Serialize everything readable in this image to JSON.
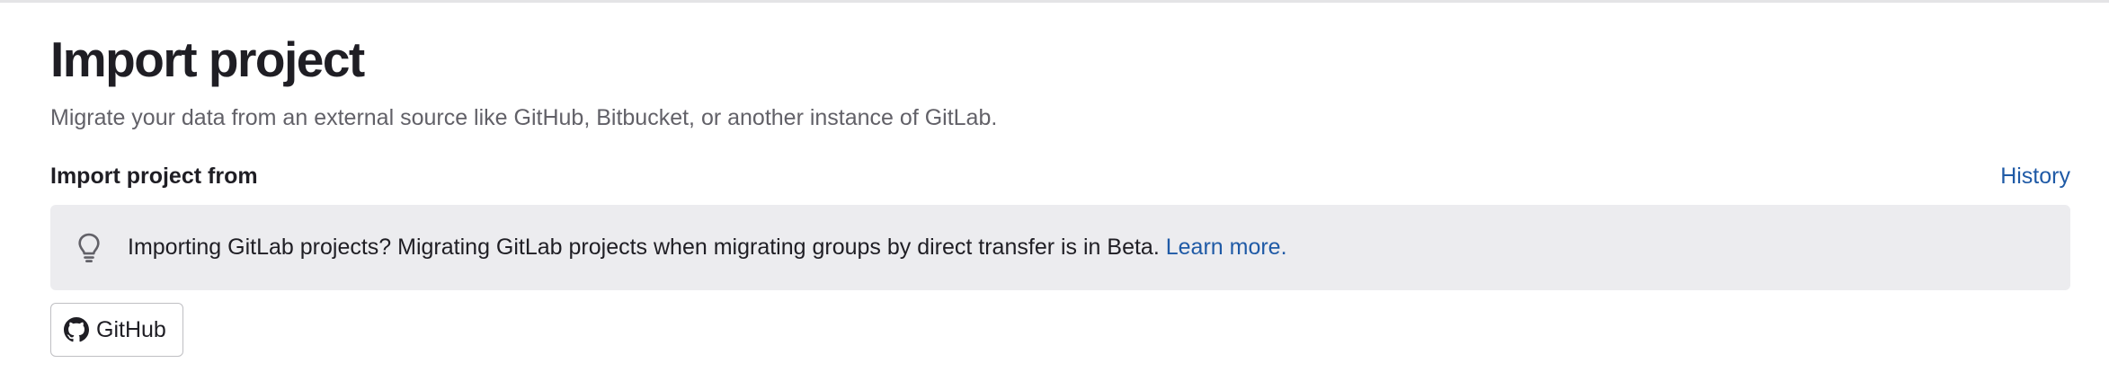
{
  "page": {
    "title": "Import project",
    "description": "Migrate your data from an external source like GitHub, Bitbucket, or another instance of GitLab."
  },
  "section": {
    "label": "Import project from",
    "history_link": "History"
  },
  "alert": {
    "icon": "lightbulb-icon",
    "text": "Importing GitLab projects? Migrating GitLab projects when migrating groups by direct transfer is in Beta.",
    "link_text": "Learn more."
  },
  "sources": [
    {
      "label": "GitHub",
      "icon": "github-icon"
    }
  ],
  "colors": {
    "link": "#1f5aa6",
    "alert_bg": "#ececef",
    "text_primary": "#1f1e24",
    "text_secondary": "#626168"
  }
}
